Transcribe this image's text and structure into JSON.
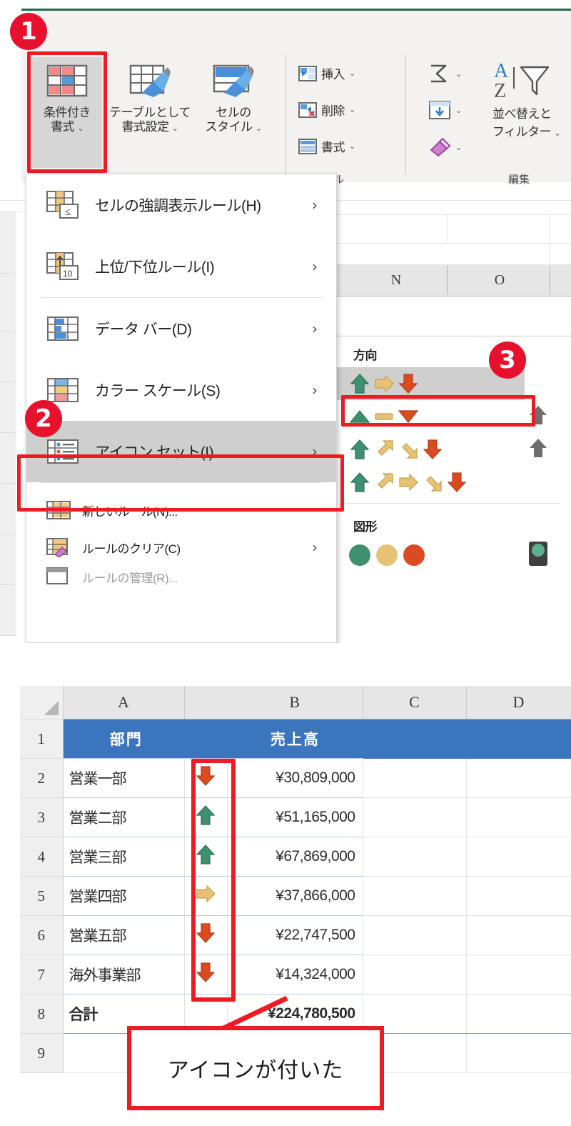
{
  "steps": {
    "one": "1",
    "two": "2",
    "three": "3"
  },
  "ribbon": {
    "buttons": [
      {
        "label_line1": "条件付き",
        "label_line2": "書式",
        "icon": "conditional-formatting-icon",
        "has_dropdown": true
      },
      {
        "label_line1": "テーブルとして",
        "label_line2": "書式設定",
        "icon": "format-as-table-icon",
        "has_dropdown": true
      },
      {
        "label_line1": "セルの",
        "label_line2": "スタイル",
        "icon": "cell-styles-icon",
        "has_dropdown": true
      }
    ],
    "cells_group": {
      "name": "セル",
      "items": [
        {
          "label": "挿入",
          "icon": "insert-cells-icon",
          "chevron": "⌄"
        },
        {
          "label": "削除",
          "icon": "delete-cells-icon",
          "chevron": "⌄"
        },
        {
          "label": "書式",
          "icon": "format-cells-icon",
          "chevron": "⌄"
        }
      ]
    },
    "editing_group": {
      "name": "編集",
      "items": [
        {
          "label": "",
          "icon": "autosum-icon",
          "chevron": "⌄"
        },
        {
          "label": "",
          "icon": "fill-icon",
          "chevron": "⌄"
        },
        {
          "label": "",
          "icon": "clear-eraser-icon",
          "chevron": "⌄"
        }
      ],
      "sort_filter": {
        "label_line1": "並べ替えと",
        "label_line2": "フィルター",
        "icon": "sort-filter-icon",
        "chevron": "⌄"
      }
    }
  },
  "cf_menu": {
    "items": [
      {
        "label": "セルの強調表示ルール(H)",
        "icon": "highlight-cells-rules-icon",
        "submenu_arrow": "›",
        "size": "large"
      },
      {
        "label": "上位/下位ルール(I)",
        "icon": "top-bottom-rules-icon",
        "submenu_arrow": "›",
        "size": "large"
      },
      {
        "label": "データ バー(D)",
        "icon": "data-bars-icon",
        "submenu_arrow": "›",
        "size": "large"
      },
      {
        "label": "カラー スケール(S)",
        "icon": "color-scales-icon",
        "submenu_arrow": "›",
        "size": "large"
      },
      {
        "label": "アイコン セット(I)",
        "icon": "icon-sets-icon",
        "submenu_arrow": "›",
        "size": "large",
        "selected": true
      },
      {
        "label": "新しいルール(N)...",
        "icon": "new-rule-icon",
        "submenu_arrow": "",
        "size": "small"
      },
      {
        "label": "ルールのクリア(C)",
        "icon": "clear-rules-icon",
        "submenu_arrow": "›",
        "size": "small"
      },
      {
        "label": "ルールの管理(R)...",
        "icon": "manage-rules-icon",
        "submenu_arrow": "",
        "size": "small"
      }
    ]
  },
  "iconset_panel": {
    "group_direction": "方向",
    "group_shapes": "図形",
    "direction_sets": [
      {
        "icons": [
          "arrow-up-green",
          "arrow-right-yellow",
          "arrow-down-red"
        ],
        "selected": true
      },
      {
        "icons": [
          "triangle-up-green",
          "dash-yellow",
          "triangle-down-red"
        ],
        "selected": false
      },
      {
        "icons": [
          "arrow-up-green",
          "arrow-upright-yellow",
          "arrow-downright-yellow",
          "arrow-down-red"
        ],
        "selected": false
      },
      {
        "icons": [
          "arrow-up-green",
          "arrow-upright-yellow",
          "arrow-right-yellow",
          "arrow-downright-yellow",
          "arrow-down-red"
        ],
        "selected": false
      }
    ],
    "direction_sets_col2": [
      {
        "icons": [
          "arrow-up-gray"
        ]
      },
      {
        "icons": [
          "arrow-up-gray"
        ]
      },
      {
        "icons": [
          "arrow-up-gray"
        ]
      }
    ],
    "shape_sets": [
      {
        "icons": [
          "circle-green",
          "circle-yellow",
          "circle-red"
        ]
      }
    ],
    "shape_sets_col2": [
      {
        "icons": [
          "traffic-light-green"
        ]
      }
    ]
  },
  "sheet": {
    "column_headers": [
      "A",
      "B",
      "C",
      "D"
    ],
    "background_column_headers": [
      "N",
      "O"
    ],
    "row_numbers": [
      "1",
      "2",
      "3",
      "4",
      "5",
      "6",
      "7",
      "8",
      "9"
    ],
    "header_row": {
      "col_a": "部門",
      "col_b": "売上高"
    },
    "rows": [
      {
        "row": "2",
        "name": "営業一部",
        "icon": "arrow-down-red",
        "value": "¥30,809,000"
      },
      {
        "row": "3",
        "name": "営業二部",
        "icon": "arrow-up-green",
        "value": "¥51,165,000"
      },
      {
        "row": "4",
        "name": "営業三部",
        "icon": "arrow-up-green",
        "value": "¥67,869,000"
      },
      {
        "row": "5",
        "name": "営業四部",
        "icon": "arrow-right-yellow",
        "value": "¥37,866,000"
      },
      {
        "row": "6",
        "name": "営業五部",
        "icon": "arrow-down-red",
        "value": "¥22,747,500"
      },
      {
        "row": "7",
        "name": "海外事業部",
        "icon": "arrow-down-red",
        "value": "¥14,324,000"
      }
    ],
    "total_row": {
      "row": "8",
      "name": "合計",
      "value": "¥224,780,500"
    },
    "empty_row": {
      "row": "9"
    }
  },
  "callout": {
    "text": "アイコンが付いた"
  },
  "colors": {
    "accent_red": "#ed1c24",
    "badge_red": "#e8112d",
    "header_blue": "#3b75be",
    "green_arrow": "#3f9070",
    "yellow_arrow": "#e8c274",
    "red_arrow": "#dc4a22",
    "gray_arrow": "#6d6d6d",
    "excel_green": "#1e6b4a",
    "selected_gray": "#cfcfcf"
  }
}
